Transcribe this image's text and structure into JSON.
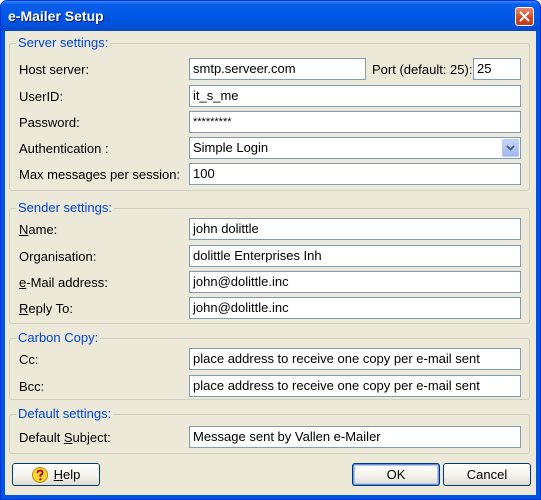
{
  "window": {
    "title": "e-Mailer Setup"
  },
  "server": {
    "legend": "Server settings:",
    "host_label": "Host server:",
    "host_value": "smtp.serveer.com",
    "port_label": "Port (default: 25):",
    "port_value": "25",
    "userid_label": "UserID:",
    "userid_value": "it_s_me",
    "password_label": "Password:",
    "password_value": "*********",
    "auth_label": "Authentication :",
    "auth_value": "Simple Login",
    "max_label": "Max messages per session:",
    "max_value": "100"
  },
  "sender": {
    "legend": "Sender settings:",
    "name_label_u": "N",
    "name_label_rest": "ame:",
    "name_value": "john dolittle",
    "org_label": "Organisation:",
    "org_value": "dolittle Enterprises Inh",
    "email_label_u": "e",
    "email_label_rest": "-Mail address:",
    "email_value": "john@dolittle.inc",
    "reply_label_u": "R",
    "reply_label_rest": "eply To:",
    "reply_value": "john@dolittle.inc"
  },
  "cc": {
    "legend": "Carbon Copy:",
    "cc_label": "Cc:",
    "cc_value": "place address to receive one copy per e-mail  sent",
    "bcc_label": "Bcc:",
    "bcc_value": "place address to receive one copy per e-mail  sent"
  },
  "defaults": {
    "legend": "Default settings:",
    "subject_label_pre": "Default ",
    "subject_label_u": "S",
    "subject_label_rest": "ubject:",
    "subject_value": "Message sent by Vallen e-Mailer"
  },
  "buttons": {
    "help_u": "H",
    "help_rest": "elp",
    "ok": "OK",
    "cancel": "Cancel"
  },
  "colors": {
    "titlebar": "#0058E6",
    "legend": "#0046D5",
    "face": "#ECE9D8"
  }
}
